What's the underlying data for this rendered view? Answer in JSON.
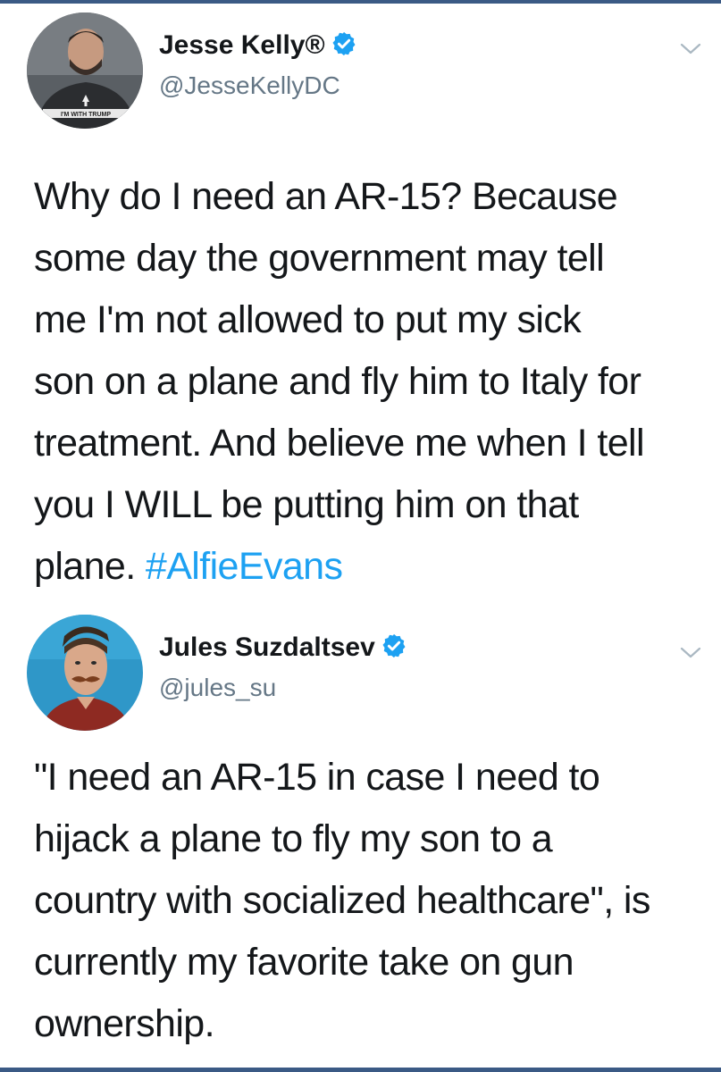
{
  "tweets": [
    {
      "display_name": "Jesse Kelly®",
      "handle": "@JesseKellyDC",
      "verified": true,
      "avatar_icon": "user-avatar-photo",
      "avatar_shirt_text": "I'M WITH TRUMP",
      "lines": [
        "Why do I need an AR-15? Because",
        "some day the government may tell",
        "me I'm not allowed to put my sick",
        "son on a plane and fly him to Italy for",
        "treatment. And believe me when I tell",
        "you I WILL be putting him on that"
      ],
      "last_line_text": "plane. ",
      "hashtag": "#AlfieEvans"
    },
    {
      "display_name": "Jules Suzdaltsev",
      "handle": "@jules_su",
      "verified": true,
      "avatar_icon": "user-avatar-photo",
      "lines": [
        "\"I need an AR-15 in case I need to",
        "hijack a plane to fly my son to a",
        "country with socialized healthcare\", is",
        "currently my favorite take on gun",
        "ownership."
      ]
    }
  ],
  "colors": {
    "text": "#14171a",
    "secondary": "#657786",
    "link": "#1da1f2",
    "verified": "#1da1f2",
    "frame": "#3b5a85"
  }
}
